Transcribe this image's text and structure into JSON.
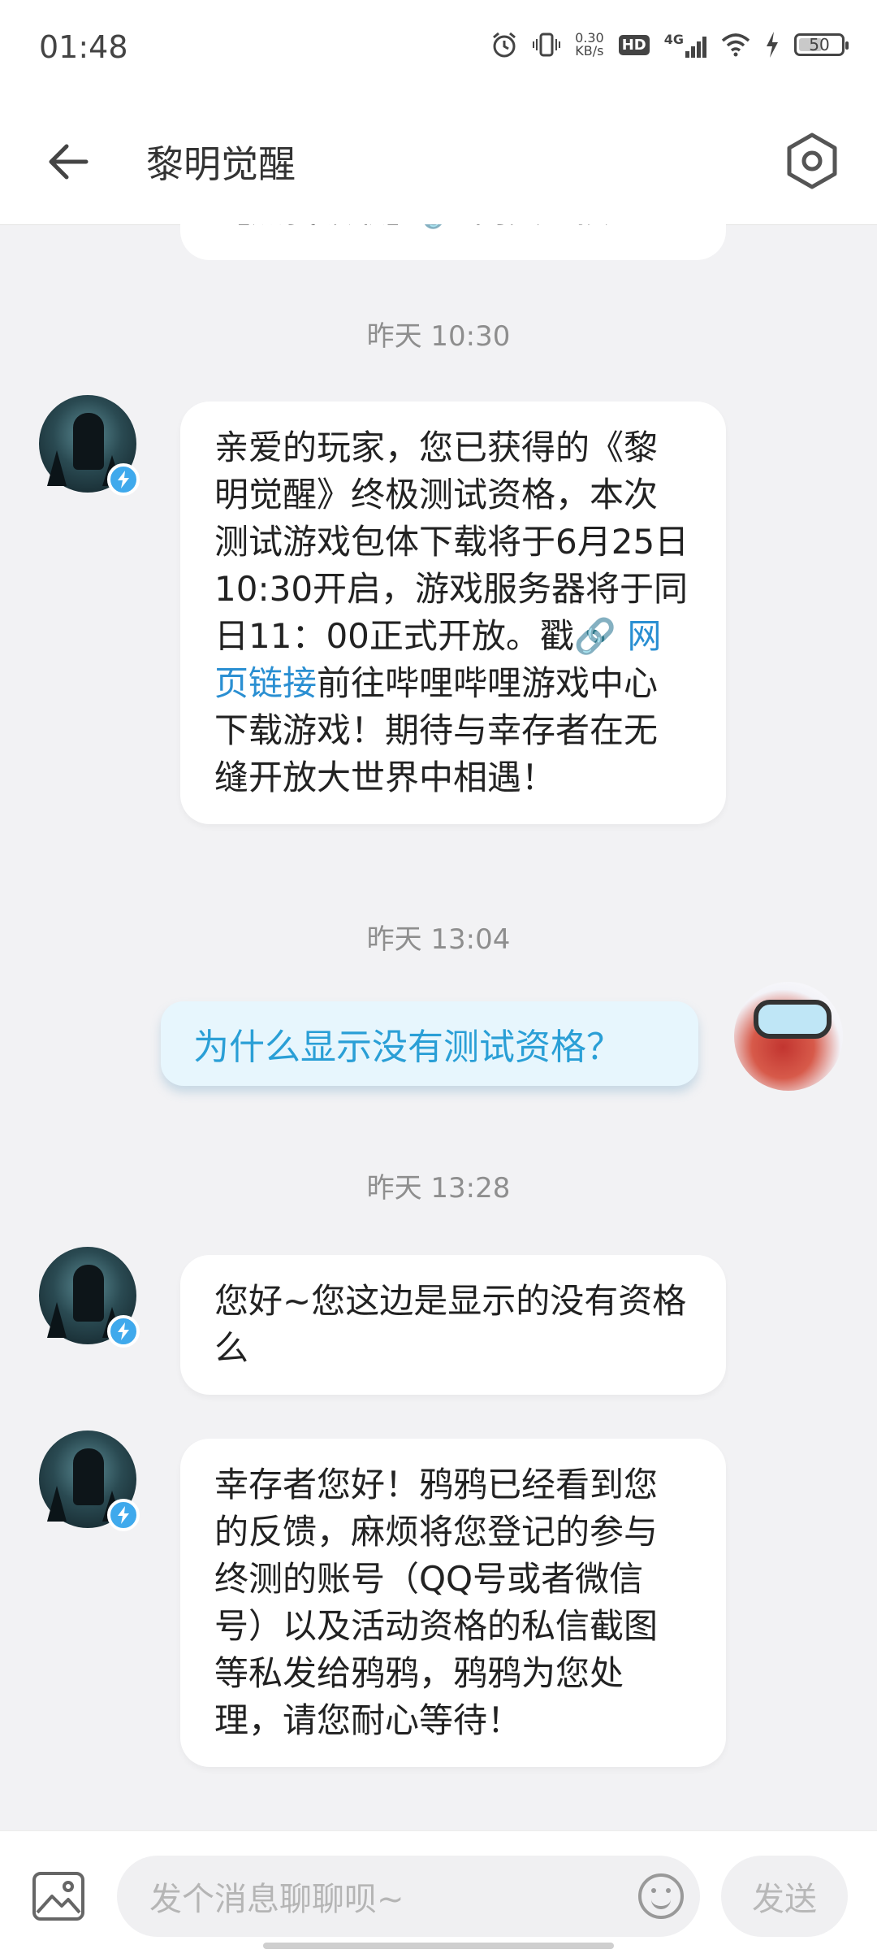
{
  "status_bar": {
    "time": "01:48",
    "speed_value": "0.30",
    "speed_unit": "KB/s",
    "hd_label": "HD",
    "network": "4G",
    "battery": "50",
    "icons": [
      "alarm-icon",
      "vibrate-icon",
      "hd-icon",
      "signal-icon",
      "wifi-icon",
      "charging-icon",
      "battery-icon"
    ]
  },
  "header": {
    "title": "黎明觉醒",
    "back_icon": "arrow-left-icon",
    "settings_icon": "hexagon-settings-icon"
  },
  "chat": {
    "partial_message": "【点我领取】🔗 网页链接",
    "messages": [
      {
        "timestamp": "昨天 10:30",
        "side": "left",
        "text_before_link": "亲爱的玩家，您已获得的《黎明觉醒》终极测试资格，本次测试游戏包体下载将于6月25日10:30开启，游戏服务器将于同日11：00正式开放。戳",
        "link_icon": "🔗",
        "link_text": "网页链接",
        "text_after_link": "前往哔哩哔哩游戏中心下载游戏！期待与幸存者在无缝开放大世界中相遇！"
      },
      {
        "timestamp": "昨天 13:04",
        "side": "right",
        "text": "为什么显示没有测试资格？"
      },
      {
        "timestamp": "昨天 13:28",
        "side": "left",
        "text": "您好~您这边是显示的没有资格么"
      },
      {
        "side": "left",
        "text": "幸存者您好！鸦鸦已经看到您的反馈，麻烦将您登记的参与终测的账号（QQ号或者微信号）以及活动资格的私信截图等私发给鸦鸦，鸦鸦为您处理，请您耐心等待！"
      }
    ]
  },
  "input_bar": {
    "placeholder": "发个消息聊聊呗~",
    "send_label": "发送",
    "image_icon": "image-icon",
    "emoji_icon": "smiley-icon"
  },
  "colors": {
    "accent": "#2a8fd2",
    "badge": "#3fa9ec",
    "right_bubble_bg": "#e7f6fd",
    "background": "#f2f2f4"
  }
}
